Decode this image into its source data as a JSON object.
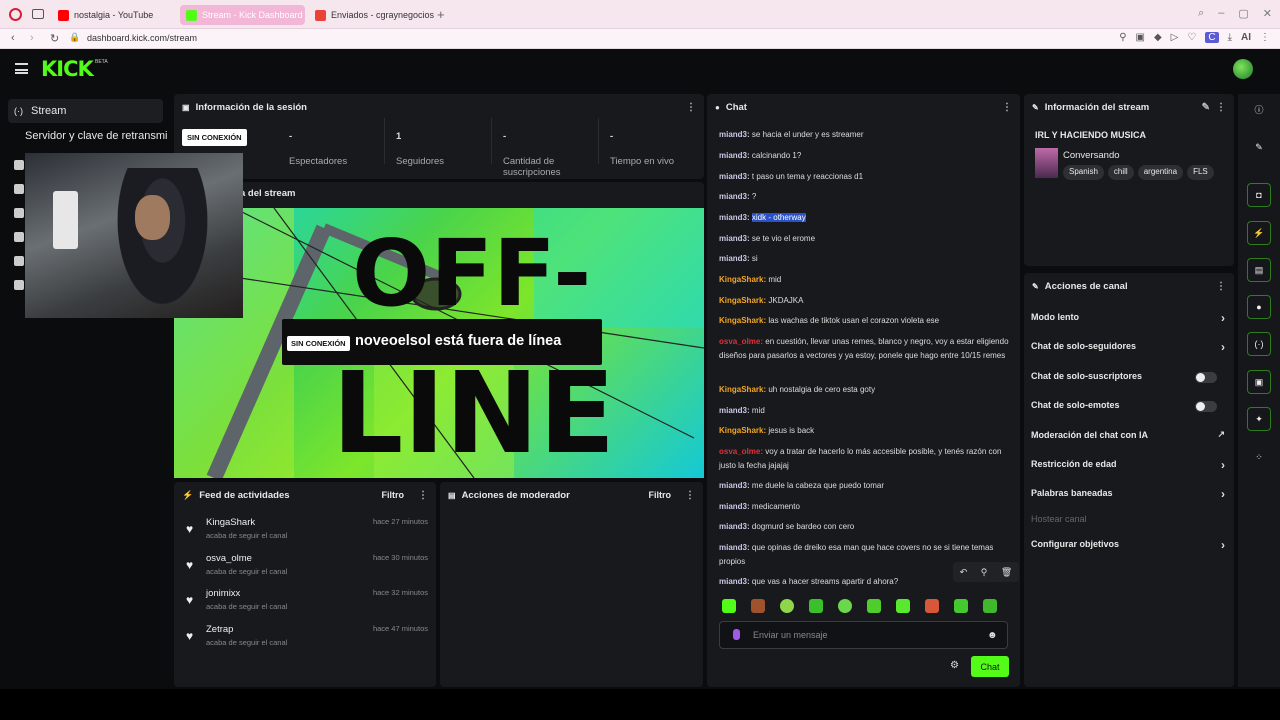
{
  "browser": {
    "tabs": [
      {
        "label": "nostalgia - YouTube",
        "fav_color": "#ff0000"
      },
      {
        "label": "Stream - Kick Dashboard",
        "fav_color": "#53fc18"
      },
      {
        "label": "Enviados - cgraynegocios@",
        "fav_color": "#ea4335"
      }
    ],
    "new_tab": "+",
    "url": "dashboard.kick.com/stream",
    "ai_label": "AI",
    "profile": "C"
  },
  "top": {
    "logo": "KICK",
    "beta": "BETA"
  },
  "nav": {
    "stream": "Stream",
    "servidor": "Servidor y clave de retransmi"
  },
  "session": {
    "title": "Información de la sesión",
    "badge": "SIN CONEXIÓN",
    "stats": [
      {
        "value": "-",
        "label": "Espectadores"
      },
      {
        "value": "1",
        "label": "Seguidores"
      },
      {
        "value": "-",
        "label": "Cantidad de suscripciones"
      },
      {
        "value": "-",
        "label": "Tiempo en vivo"
      }
    ]
  },
  "preview": {
    "title": "a del stream",
    "word1": "OFF-",
    "word2": "LINE",
    "badge": "SIN CONEXIÓN",
    "message": "noveoelsol está fuera de línea"
  },
  "feed": {
    "title": "Feed de actividades",
    "filter": "Filtro",
    "items": [
      {
        "name": "KingaShark",
        "sub": "acaba de seguir el canal",
        "time": "hace 27 minutos"
      },
      {
        "name": "osva_olme",
        "sub": "acaba de seguir el canal",
        "time": "hace 30 minutos"
      },
      {
        "name": "jonimixx",
        "sub": "acaba de seguir el canal",
        "time": "hace 32 minutos"
      },
      {
        "name": "Zetrap",
        "sub": "acaba de seguir el canal",
        "time": "hace 47 minutos"
      }
    ]
  },
  "mod": {
    "title": "Acciones de moderador",
    "filter": "Filtro"
  },
  "chat": {
    "title": "Chat",
    "messages": [
      {
        "user": "miand3:",
        "text": "se hacia el under y es streamer",
        "color": "#c9c9e6"
      },
      {
        "user": "miand3:",
        "text": "calcinando 1?",
        "color": "#c9c9e6"
      },
      {
        "user": "miand3:",
        "text": "t paso un tema y reaccionas d1",
        "color": "#c9c9e6"
      },
      {
        "user": "miand3:",
        "text": "?",
        "color": "#c9c9e6"
      },
      {
        "user": "miand3:",
        "text": "xidk - otherway",
        "color": "#c9c9e6"
      },
      {
        "user": "miand3:",
        "text": "se te vio el erome",
        "color": "#c9c9e6"
      },
      {
        "user": "miand3:",
        "text": "si",
        "color": "#c9c9e6"
      },
      {
        "user": "KingaShark:",
        "text": "mid",
        "color": "#f5a623"
      },
      {
        "user": "KingaShark:",
        "text": "JKDAJKA",
        "color": "#f5a623"
      },
      {
        "user": "KingaShark:",
        "text": "las wachas de tiktok usan el corazon violeta ese",
        "color": "#f5a623"
      },
      {
        "user": "osva_olme:",
        "text": "en cuestión, llevar unas remes, blanco y negro, voy a estar eligiendo diseños para pasarlos a vectores y ya estoy, ponele que hago entre 10/15 remes",
        "color": "#e0303a"
      },
      {
        "user": "KingaShark:",
        "text": "uh nostalgia de cero esta goty",
        "color": "#f5a623"
      },
      {
        "user": "miand3:",
        "text": "mid",
        "color": "#c9c9e6"
      },
      {
        "user": "KingaShark:",
        "text": "jesus is back",
        "color": "#f5a623"
      },
      {
        "user": "osva_olme:",
        "text": "voy a tratar de hacerlo lo más accesible posible, y tenés razón con justo la fecha jajajaj",
        "color": "#e0303a"
      },
      {
        "user": "miand3:",
        "text": "me duele la cabeza que puedo tomar",
        "color": "#c9c9e6"
      },
      {
        "user": "miand3:",
        "text": "medicamento",
        "color": "#c9c9e6"
      },
      {
        "user": "miand3:",
        "text": "dogmurd se bardeo con cero",
        "color": "#c9c9e6"
      },
      {
        "user": "miand3:",
        "text": "que opinas de dreiko esa man que hace covers no se si tiene temas propios",
        "color": "#c9c9e6"
      },
      {
        "user": "miand3:",
        "text": "que vas a hacer streams apartir d ahora?",
        "color": "#c9c9e6"
      }
    ],
    "placeholder": "Enviar un mensaje",
    "send": "Chat"
  },
  "stream_info": {
    "title": "Información del stream",
    "stream_title": "IRL Y HACIENDO MUSICA",
    "category": "Conversando",
    "tags": [
      "Spanish",
      "chill",
      "argentina",
      "FLS"
    ]
  },
  "actions": {
    "title": "Acciones de canal",
    "items": [
      {
        "label": "Modo lento",
        "control": "chevron"
      },
      {
        "label": "Chat de solo-seguidores",
        "control": "chevron"
      },
      {
        "label": "Chat de solo-suscriptores",
        "control": "toggle"
      },
      {
        "label": "Chat de solo-emotes",
        "control": "toggle"
      },
      {
        "label": "Moderación del chat con IA",
        "control": "external"
      },
      {
        "label": "Restricción de edad",
        "control": "chevron"
      },
      {
        "label": "Palabras baneadas",
        "control": "chevron"
      },
      {
        "label": "Hostear canal",
        "control": "none"
      },
      {
        "label": "Configurar objetivos",
        "control": "chevron"
      }
    ]
  },
  "colors": {
    "accent": "#53fc18",
    "panel": "#18191c",
    "bg": "#0b0c0e"
  }
}
